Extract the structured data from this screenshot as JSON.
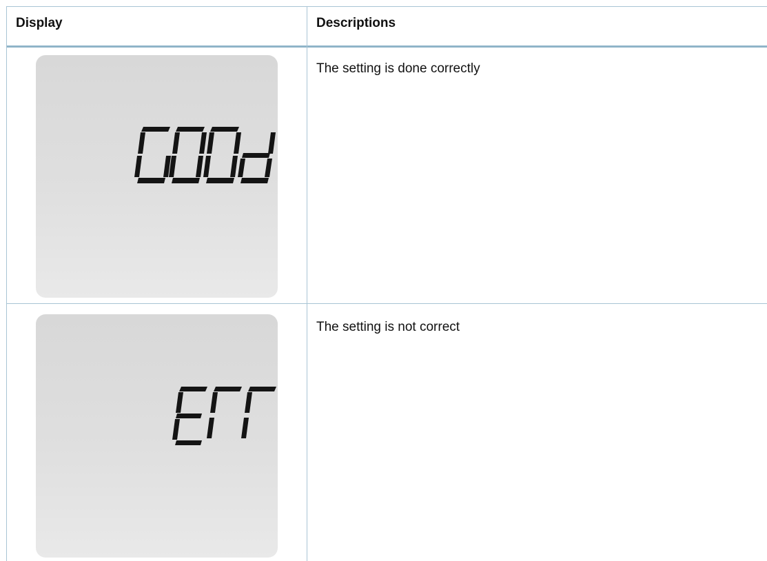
{
  "table": {
    "headers": {
      "display": "Display",
      "descriptions": "Descriptions"
    },
    "rows": [
      {
        "display_reading": "GOOd",
        "description": "The setting is done correctly"
      },
      {
        "display_reading": "Err",
        "description": "The setting is not correct"
      }
    ]
  },
  "colors": {
    "border": "#a8c4d4",
    "lcd_background": "#dcdcdc",
    "segment": "#141414"
  }
}
